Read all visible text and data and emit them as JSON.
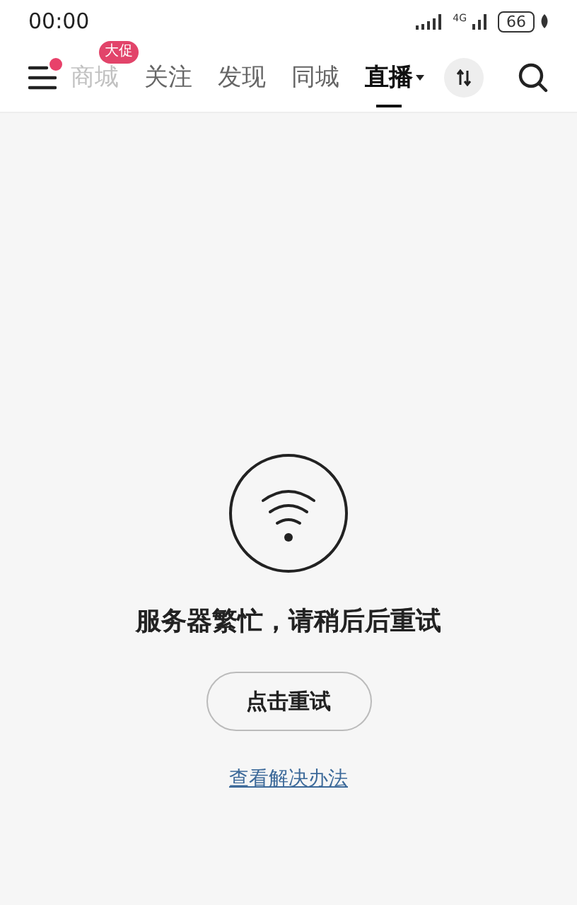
{
  "status_bar": {
    "time": "00:00",
    "network": "4G",
    "battery": "66"
  },
  "nav": {
    "menu_badge": true,
    "tabs": [
      {
        "label": "商城",
        "selected": false,
        "faded": true,
        "badge": "大促"
      },
      {
        "label": "关注",
        "selected": false,
        "faded": false
      },
      {
        "label": "发现",
        "selected": false,
        "faded": false
      },
      {
        "label": "同城",
        "selected": false,
        "faded": false
      },
      {
        "label": "直播",
        "selected": true,
        "faded": false
      }
    ]
  },
  "error": {
    "message": "服务器繁忙，请稍后后重试",
    "retry_button": "点击重试",
    "help_link": "查看解决办法"
  }
}
